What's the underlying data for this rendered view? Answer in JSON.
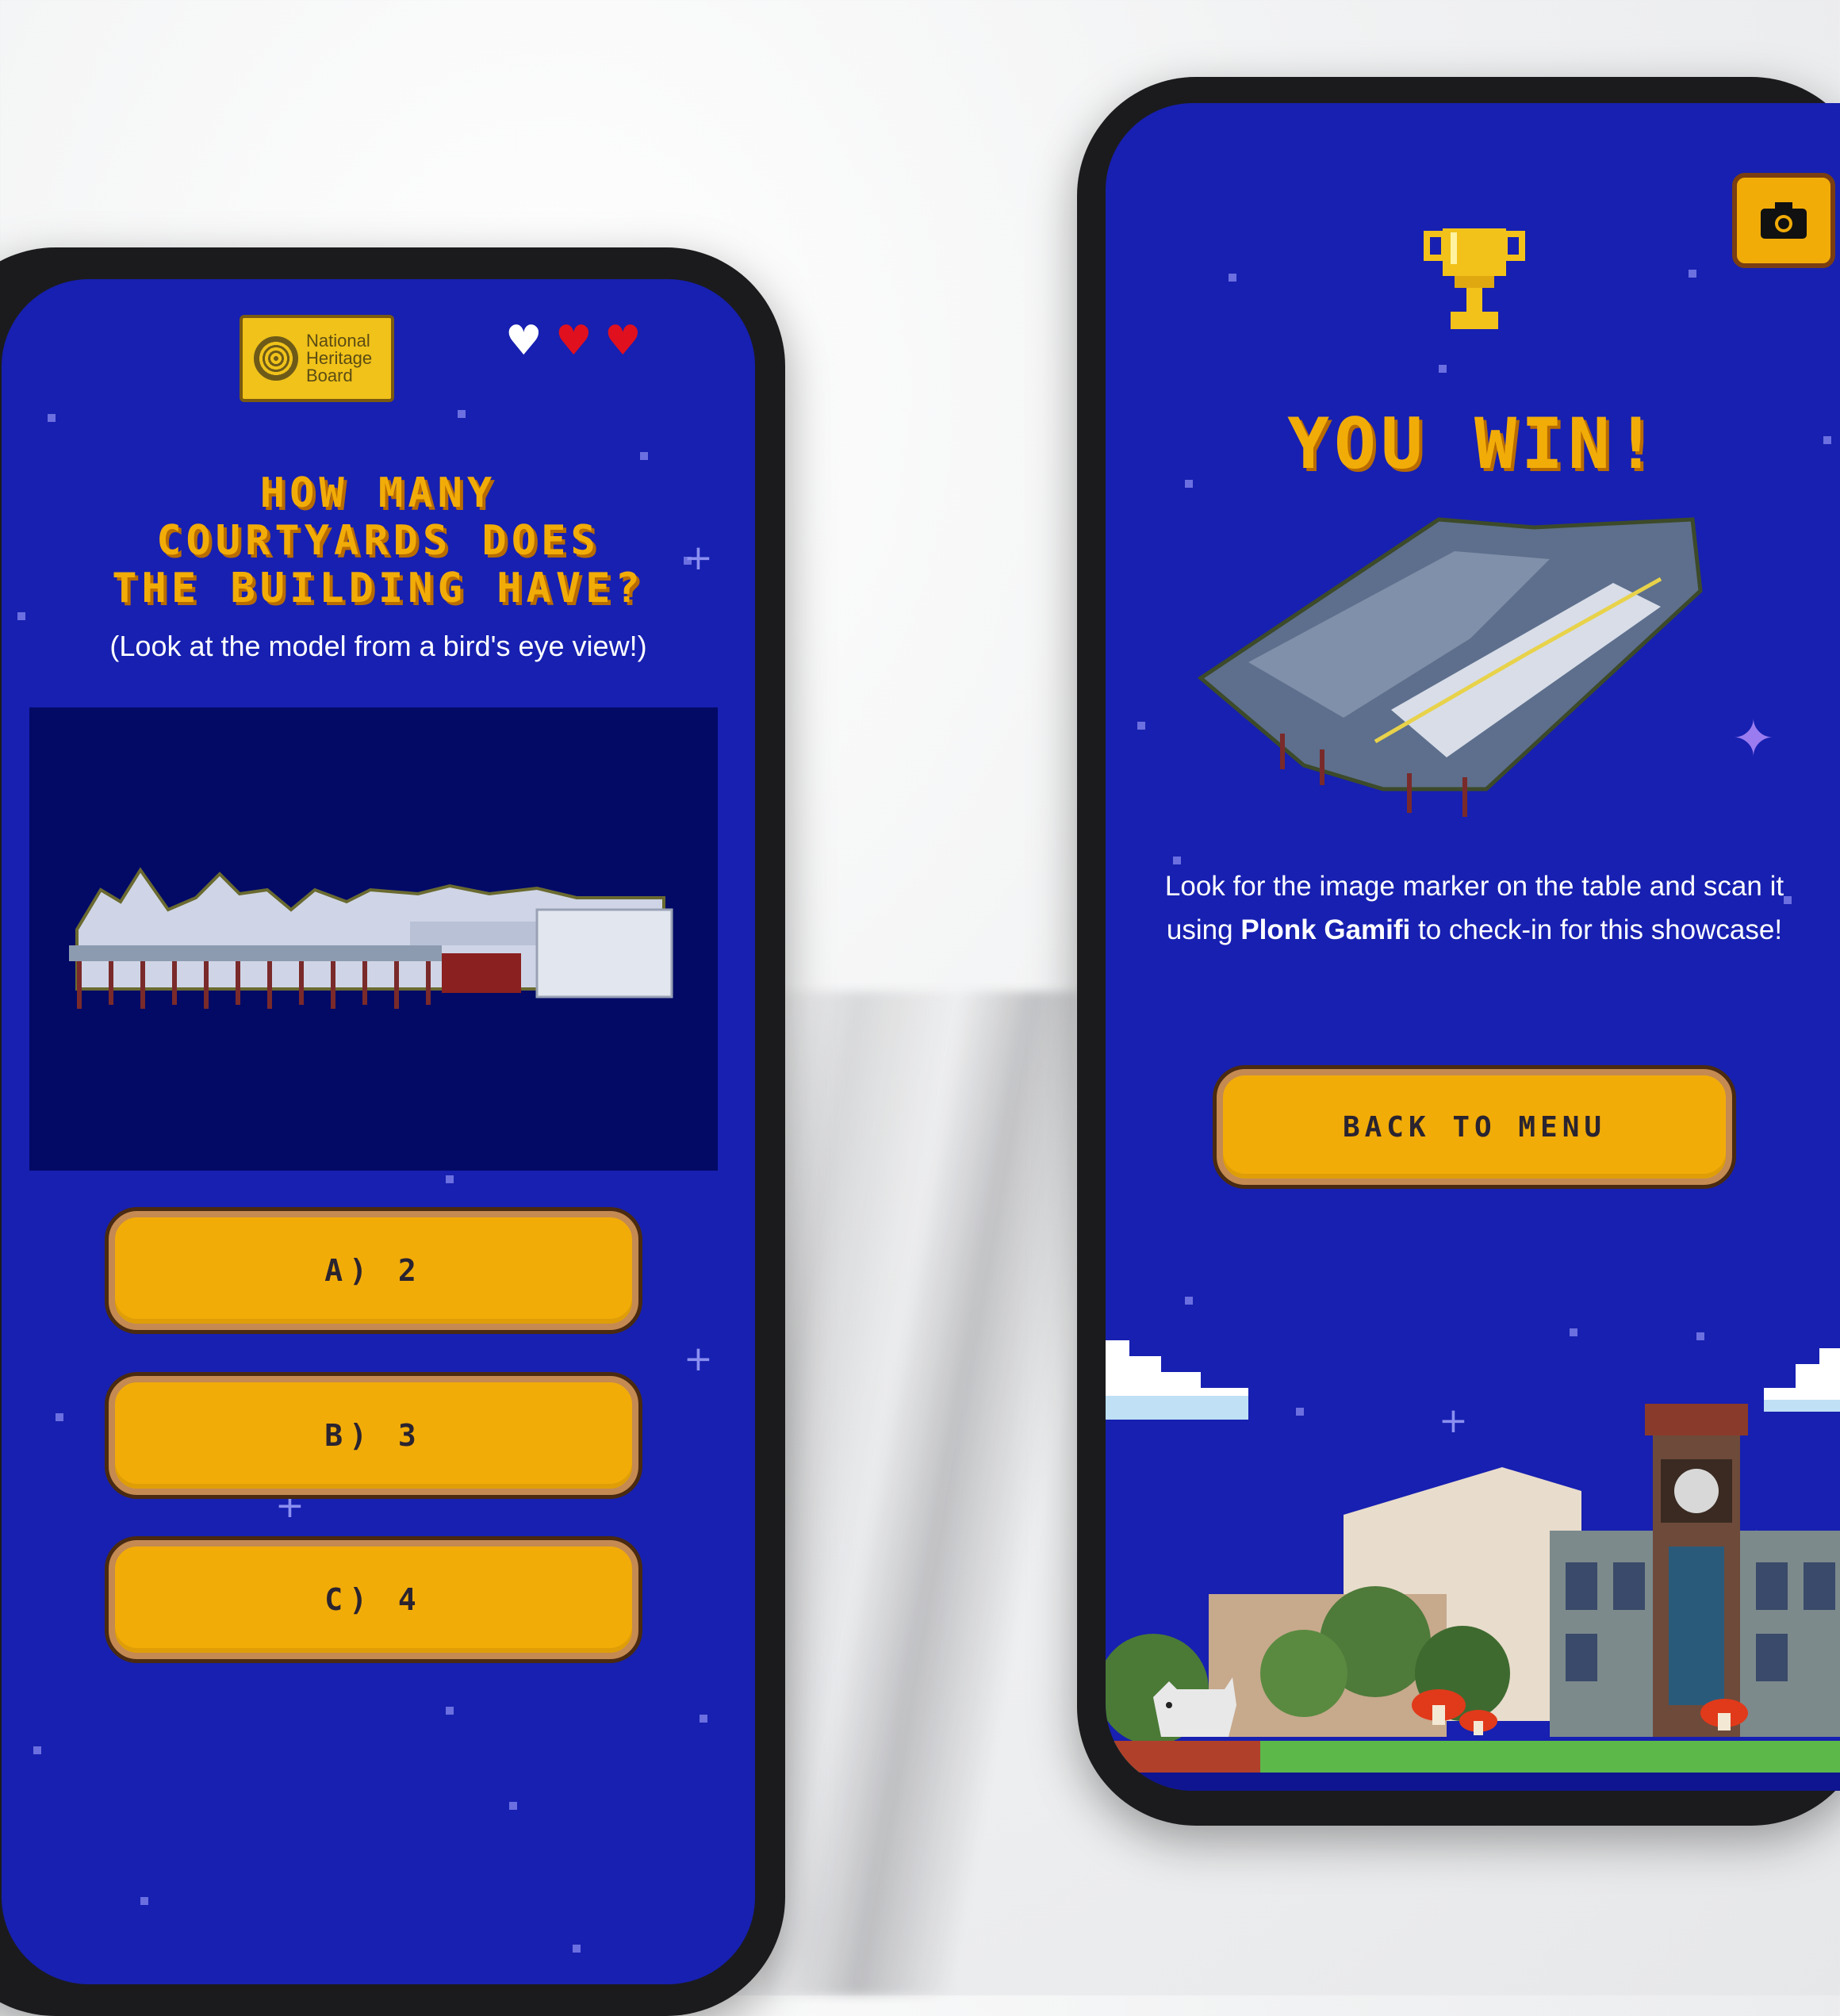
{
  "quiz_screen": {
    "logo_text": [
      "National",
      "Heritage",
      "Board"
    ],
    "lives": [
      {
        "icon": "heart-empty-icon",
        "glyph": "♥",
        "color": "#ffffff"
      },
      {
        "icon": "heart-full-icon",
        "glyph": "♥",
        "color": "#e0101e"
      },
      {
        "icon": "heart-full-icon",
        "glyph": "♥",
        "color": "#e0101e"
      }
    ],
    "question_lines": [
      "HOW MANY",
      "COURTYARDS DOES",
      "THE BUILDING HAVE?"
    ],
    "hint": "(Look at the model from a bird's eye view!)",
    "answers": [
      {
        "label": "A) 2"
      },
      {
        "label": "B) 3"
      },
      {
        "label": "C) 4"
      }
    ]
  },
  "win_screen": {
    "trophy_icon": "trophy-icon",
    "title": "YOU WIN!",
    "message_before": "Look for the image marker on the table and scan it using ",
    "message_brand": "Plonk Gamifi",
    "message_after": " to check-in for this showcase!",
    "back_button": "BACK TO MENU",
    "camera_icon": "camera-icon"
  },
  "colors": {
    "screen_bg": "#1720b0",
    "accent_gold": "#f2ac08",
    "model_bg": "#020a66"
  }
}
